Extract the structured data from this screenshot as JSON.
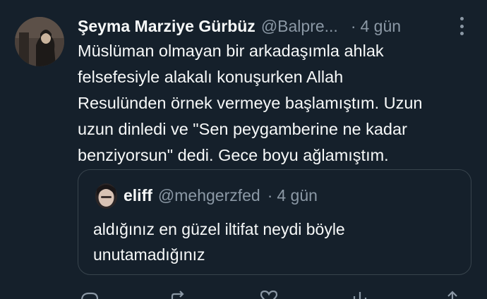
{
  "tweet": {
    "author_name": "Şeyma Marziye Gürbüz",
    "author_handle": "@Balpre...",
    "separator": "·",
    "time": "4 gün",
    "text_lines": [
      "Müslüman olmayan bir arkadaşımla ahlak",
      "felsefesiyle alakalı konuşurken Allah",
      "Resulünden örnek vermeye başlamıştım. Uzun",
      "uzun dinledi ve \"Sen peygamberine ne kadar",
      "benziyorsun\" dedi. Gece boyu ağlamıştım."
    ]
  },
  "quoted_tweet": {
    "author_name": "eliff",
    "author_handle": "@mehgerzfed",
    "separator": "·",
    "time": "4 gün",
    "text_lines": [
      "aldığınız en güzel iltifat neydi böyle",
      "unutamadığınız"
    ]
  },
  "actions": {
    "icons": [
      "reply-icon",
      "retweet-icon",
      "like-icon",
      "views-icon",
      "share-icon"
    ]
  },
  "colors": {
    "background": "#15202b",
    "primary_text": "#f7f9f9",
    "secondary_text": "#8b98a5",
    "border": "#38444d"
  }
}
